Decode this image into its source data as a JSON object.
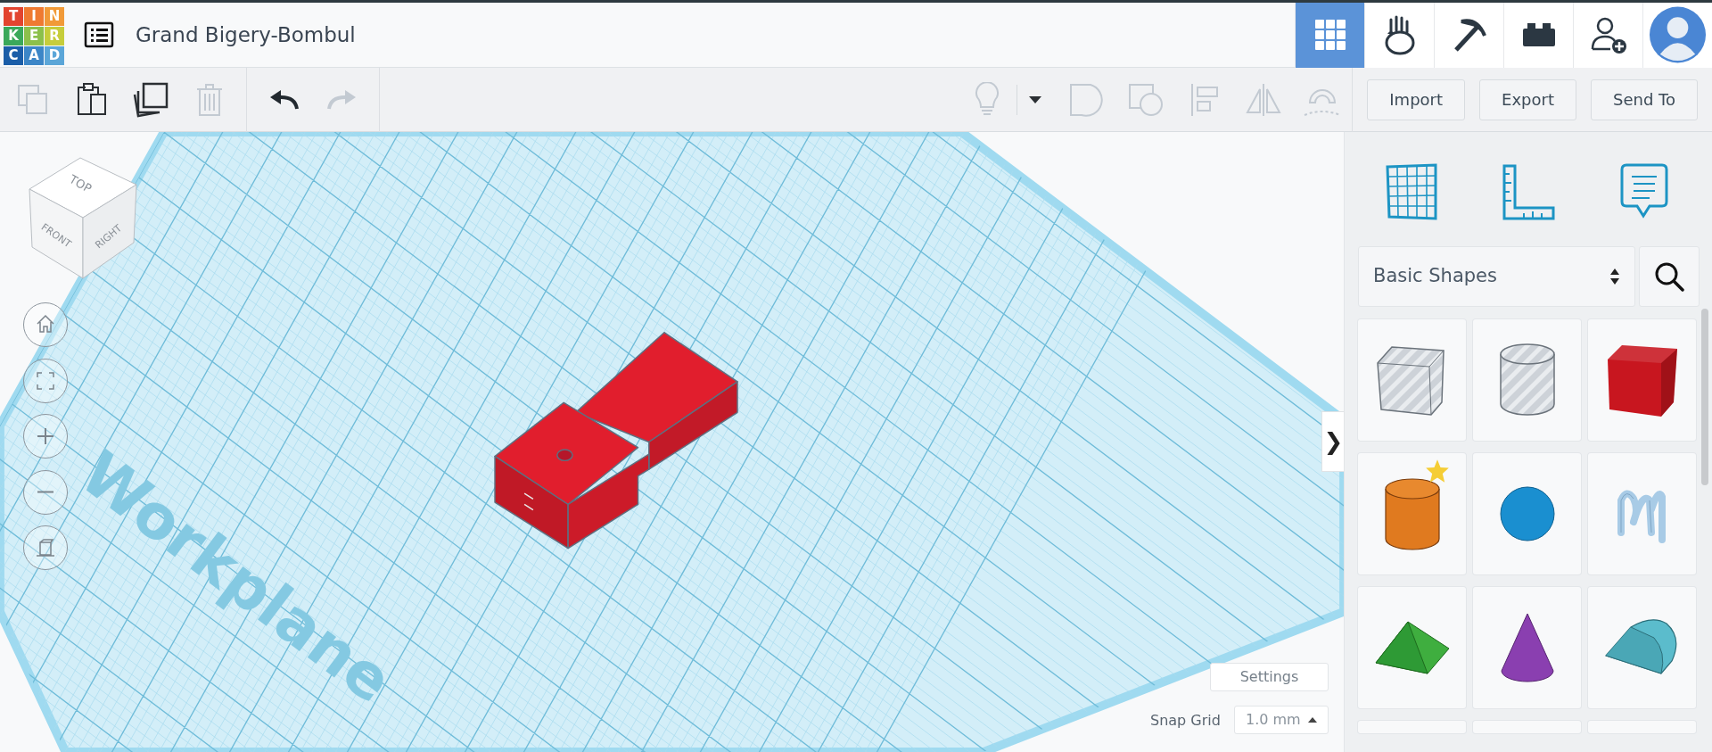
{
  "logo": {
    "letters": [
      {
        "text": "T",
        "color": "#e2442f"
      },
      {
        "text": "I",
        "color": "#ef7a31"
      },
      {
        "text": "N",
        "color": "#f19a38"
      },
      {
        "text": "K",
        "color": "#3aa85a"
      },
      {
        "text": "E",
        "color": "#8cc04b"
      },
      {
        "text": "R",
        "color": "#c6cd3b"
      },
      {
        "text": "C",
        "color": "#1b5ea8"
      },
      {
        "text": "A",
        "color": "#3c86c7"
      },
      {
        "text": "D",
        "color": "#5ba6d8"
      }
    ]
  },
  "document": {
    "title": "Grand Bigery-Bombul"
  },
  "top_nav": [
    {
      "kind": "tiles",
      "selected": true
    },
    {
      "kind": "hand",
      "selected": false
    },
    {
      "kind": "pickaxe",
      "selected": false
    },
    {
      "kind": "brick",
      "selected": false
    },
    {
      "kind": "invite",
      "selected": false
    },
    {
      "kind": "avatar",
      "selected": false
    }
  ],
  "toolbar": {
    "edit_tools": [
      {
        "kind": "copy",
        "disabled": true
      },
      {
        "kind": "paste",
        "disabled": false
      },
      {
        "kind": "duplicate",
        "disabled": false
      },
      {
        "kind": "delete",
        "disabled": true
      }
    ],
    "history": [
      {
        "kind": "undo",
        "disabled": false
      },
      {
        "kind": "redo",
        "disabled": true
      }
    ],
    "shape_tools": [
      {
        "kind": "bulb",
        "disabled": true
      },
      {
        "kind": "caret",
        "disabled": false
      },
      {
        "kind": "group",
        "disabled": true
      },
      {
        "kind": "ungroup",
        "disabled": true
      },
      {
        "kind": "align",
        "disabled": true
      },
      {
        "kind": "mirror",
        "disabled": true
      },
      {
        "kind": "magnet",
        "disabled": true
      }
    ],
    "actions": [
      "Import",
      "Export",
      "Send To"
    ]
  },
  "view_cube": {
    "faces": [
      "TOP",
      "FRONT",
      "RIGHT"
    ]
  },
  "view_controls": [
    {
      "kind": "home"
    },
    {
      "kind": "fit"
    },
    {
      "kind": "zoom_in"
    },
    {
      "kind": "zoom_out"
    },
    {
      "kind": "ortho"
    }
  ],
  "workplane": {
    "label": "Workplane"
  },
  "settings_button": "Settings",
  "snap_grid": {
    "label": "Snap Grid",
    "value": "1.0 mm"
  },
  "panel": {
    "toggle": "❯",
    "tools": [
      {
        "kind": "workplane"
      },
      {
        "kind": "ruler"
      },
      {
        "kind": "notes"
      }
    ],
    "category": "Basic Shapes",
    "shapes": [
      {
        "kind": "box_hole",
        "favorite": false
      },
      {
        "kind": "cylinder_hole",
        "favorite": false
      },
      {
        "kind": "box",
        "favorite": false,
        "color": "#c8161f"
      },
      {
        "kind": "cylinder",
        "favorite": true,
        "color": "#e07a1f"
      },
      {
        "kind": "sphere",
        "favorite": false,
        "color": "#1a8fd0"
      },
      {
        "kind": "scribble",
        "favorite": false,
        "color": "#a8cbe6"
      },
      {
        "kind": "roof",
        "favorite": false,
        "color": "#3fae3f"
      },
      {
        "kind": "cone",
        "favorite": false,
        "color": "#8a3fb0"
      },
      {
        "kind": "round_roof",
        "favorite": false,
        "color": "#5bbccc"
      },
      {
        "kind": "partial",
        "favorite": false
      },
      {
        "kind": "partial",
        "favorite": false
      },
      {
        "kind": "partial",
        "favorite": false
      }
    ]
  }
}
